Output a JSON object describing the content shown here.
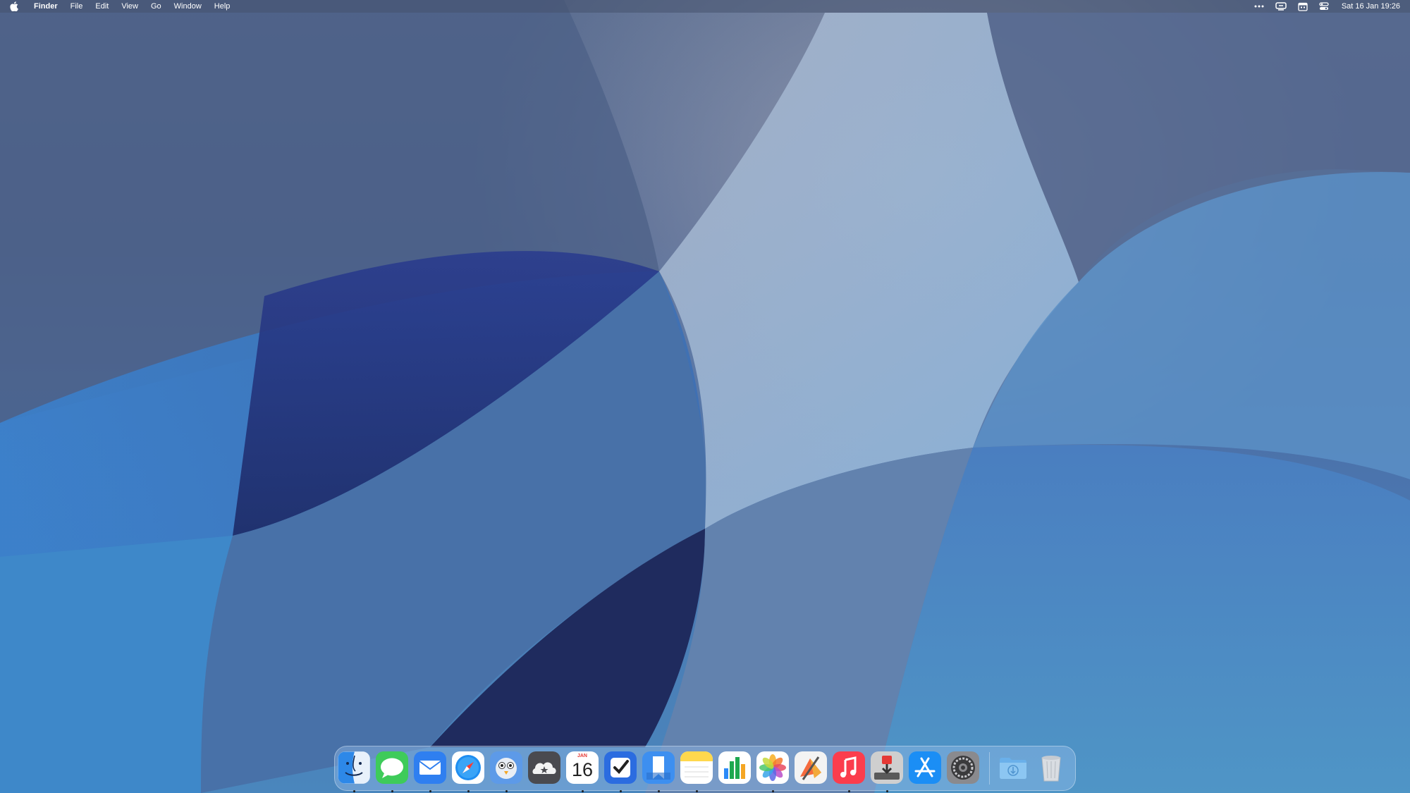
{
  "menubar": {
    "app_name": "Finder",
    "menus": [
      "File",
      "Edit",
      "View",
      "Go",
      "Window",
      "Help"
    ],
    "clock": "Sat 16 Jan  19:26",
    "status_icons": [
      "more-icon",
      "screen-mirroring-icon",
      "calendar-status-icon",
      "control-center-icon"
    ]
  },
  "dock": {
    "items": [
      {
        "name": "Finder",
        "icon": "finder-icon",
        "running": true
      },
      {
        "name": "Messages",
        "icon": "messages-icon",
        "running": true
      },
      {
        "name": "Mail",
        "icon": "mail-icon",
        "running": true
      },
      {
        "name": "Safari",
        "icon": "safari-icon",
        "running": true
      },
      {
        "name": "Tweetbot",
        "icon": "tweetbot-icon",
        "running": true
      },
      {
        "name": "Reeder",
        "icon": "reeder-icon",
        "running": false
      },
      {
        "name": "Calendar",
        "icon": "calendar-icon",
        "running": true
      },
      {
        "name": "Things",
        "icon": "things-icon",
        "running": true
      },
      {
        "name": "Bookmarks",
        "icon": "bookmarks-icon",
        "running": true
      },
      {
        "name": "Notes",
        "icon": "notes-icon",
        "running": true
      },
      {
        "name": "Numbers",
        "icon": "numbers-icon",
        "running": false
      },
      {
        "name": "Photos",
        "icon": "photos-icon",
        "running": true
      },
      {
        "name": "Pixelmator Pro",
        "icon": "pixelmator-icon",
        "running": false
      },
      {
        "name": "Music",
        "icon": "music-icon",
        "running": true
      },
      {
        "name": "Transmit",
        "icon": "transmit-icon",
        "running": true
      },
      {
        "name": "App Store",
        "icon": "app-store-icon",
        "running": false
      },
      {
        "name": "System Preferences",
        "icon": "system-preferences-icon",
        "running": false
      }
    ],
    "calendar_month": "JAN",
    "calendar_day": "16",
    "downloads": {
      "name": "Downloads",
      "icon": "downloads-folder-icon"
    },
    "trash": {
      "name": "Trash",
      "icon": "trash-icon"
    }
  },
  "colors": {
    "accent": "#3a7bd5",
    "messages_green": "#34c759",
    "music_red": "#fb3d4d",
    "notes_yellow": "#ffd84d"
  }
}
